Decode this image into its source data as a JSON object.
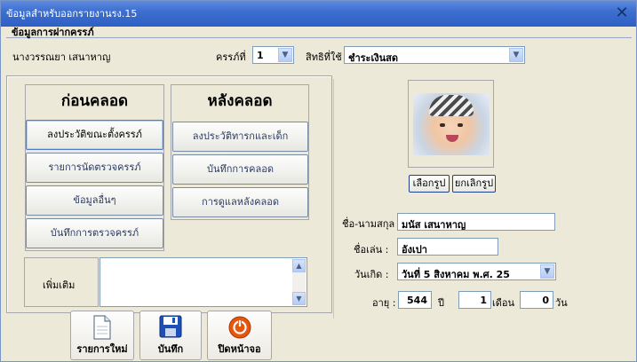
{
  "window": {
    "title": "ข้อมูลสำหรับออกรายงานรง.15",
    "close_glyph": "✕"
  },
  "group": {
    "title": "ข้อมูลการฝากครรภ์"
  },
  "patient": {
    "name": "นางวรรณยา เสนาหาญ"
  },
  "pregnancy": {
    "label": "ครรภ์ที่",
    "value": "1"
  },
  "rights": {
    "label": "สิทธิที่ใช้",
    "value": "ชำระเงินสด"
  },
  "before_birth": {
    "title": "ก่อนคลอด",
    "buttons": [
      "ลงประวัติขณะตั้งครรภ์",
      "รายการนัดตรวจครรภ์",
      "ข้อมูลอื่นๆ",
      "บันทึกการตรวจครรภ์"
    ]
  },
  "after_birth": {
    "title": "หลังคลอด",
    "buttons": [
      "ลงประวัติทารกและเด็ก",
      "บันทึกการคลอด",
      "การดูแลหลังคลอด"
    ]
  },
  "notes": {
    "label": "เพิ่มเติม",
    "value": ""
  },
  "photo_buttons": {
    "select": "เลือกรูป",
    "cancel": "ยกเลิกรูป"
  },
  "child": {
    "fullname_label": "ชื่อ-นามสกุล :",
    "fullname": "มนัส เสนาหาญ",
    "nickname_label": "ชื่อเล่น :",
    "nickname": "อังเปา",
    "dob_label": "วันเกิด :",
    "dob": "วันที่  5  สิงหาคม  พ.ศ. 25",
    "age_label": "อายุ :",
    "age_days_total": "544",
    "unit_year": "ปี",
    "age_months": "1",
    "unit_month": "เดือน",
    "age_days": "0",
    "unit_day": "วัน"
  },
  "toolbar": {
    "new": "รายการใหม่",
    "save": "บันทึก",
    "close": "ปิดหน้าจอ"
  },
  "icons": {
    "close": "close-icon",
    "dropdown": "chevron-down-icon",
    "new": "document-icon",
    "save": "floppy-disk-icon",
    "power": "power-icon"
  },
  "colors": {
    "titlebar": "#2e5fc4",
    "face": "#ece9d8",
    "accent": "#e8550c"
  }
}
